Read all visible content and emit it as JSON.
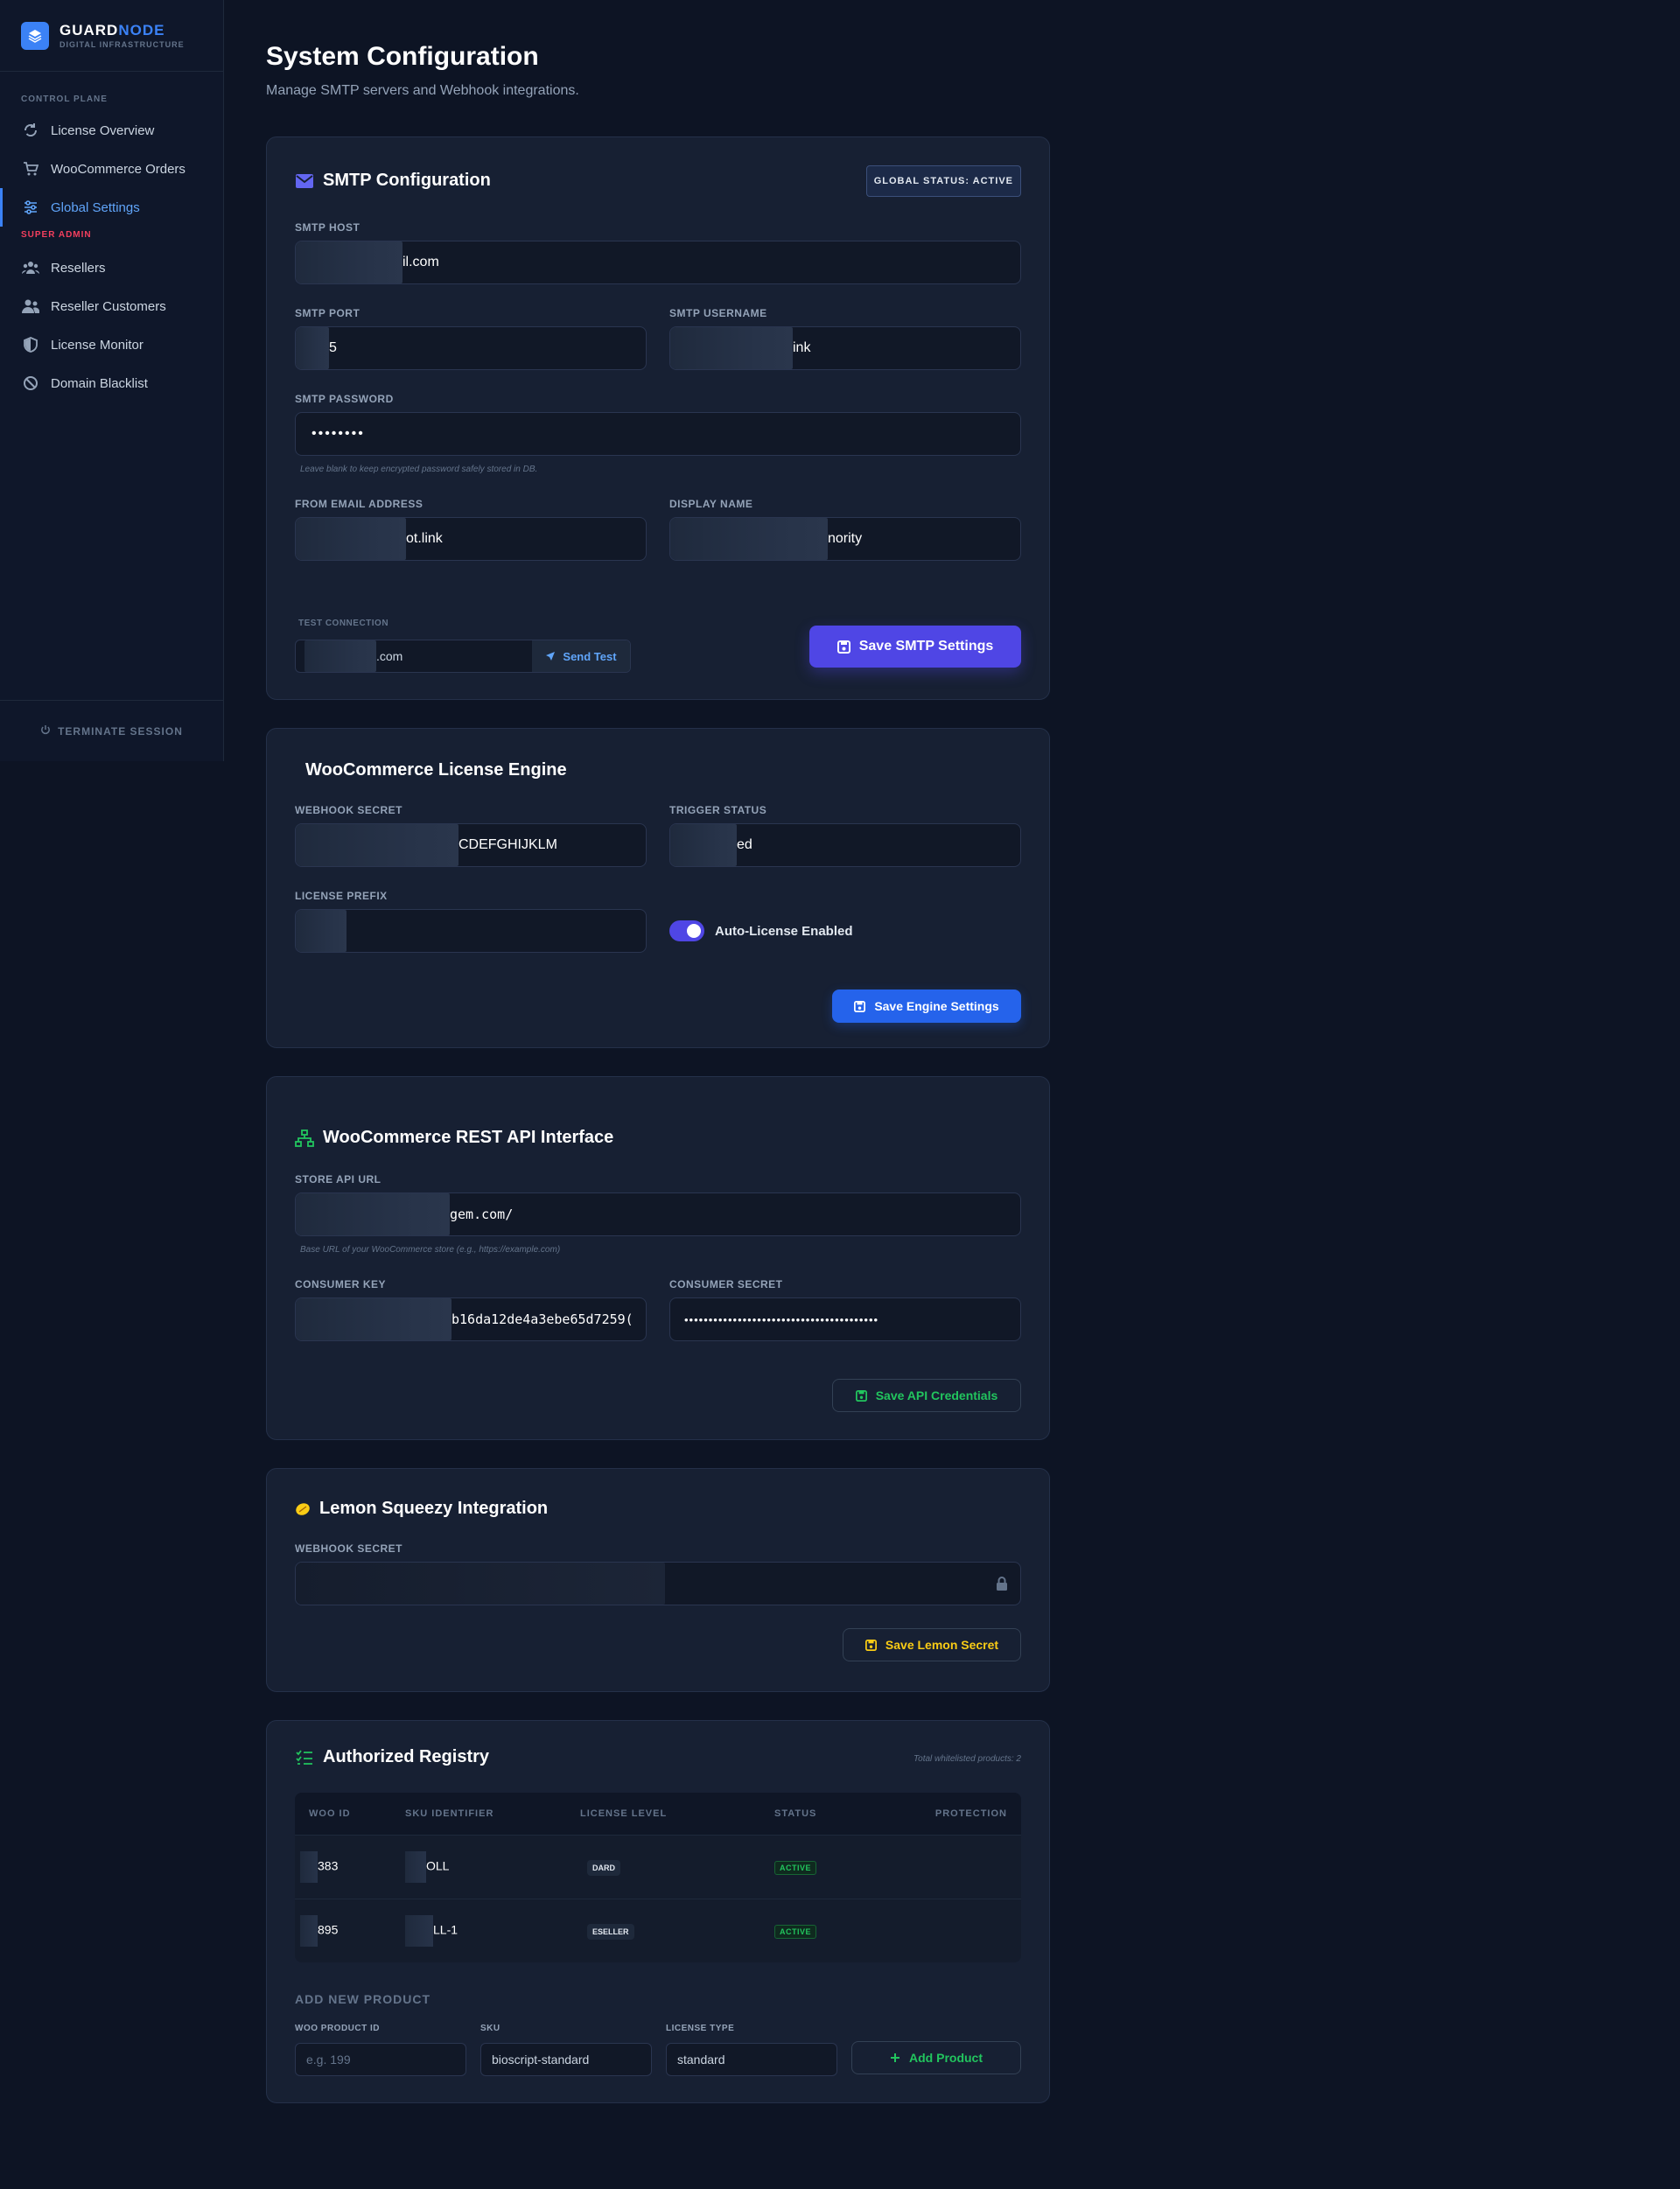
{
  "brand": {
    "name_a": "GUARD",
    "name_b": "NODE",
    "subtitle": "DIGITAL INFRASTRUCTURE"
  },
  "sidebar": {
    "section_control": "CONTROL PLANE",
    "items": [
      {
        "label": "License Overview",
        "icon": "refresh-icon"
      },
      {
        "label": "WooCommerce Orders",
        "icon": "cart-icon"
      },
      {
        "label": "Global Settings",
        "icon": "sliders-icon",
        "active": true
      }
    ],
    "section_admin": "SUPER ADMIN",
    "admin_items": [
      {
        "label": "Resellers",
        "icon": "users-group-icon"
      },
      {
        "label": "Reseller Customers",
        "icon": "users-icon"
      },
      {
        "label": "License Monitor",
        "icon": "shield-icon"
      },
      {
        "label": "Domain Blacklist",
        "icon": "ban-icon"
      }
    ],
    "footer": "TERMINATE SESSION"
  },
  "header": {
    "title": "System Configuration",
    "subtitle": "Manage SMTP servers and Webhook integrations."
  },
  "smtp": {
    "title": "SMTP Configuration",
    "status_badge": "GLOBAL STATUS: ACTIVE",
    "host_label": "SMTP HOST",
    "host_value": "il.com",
    "port_label": "SMTP PORT",
    "port_value": "5",
    "username_label": "SMTP USERNAME",
    "username_value": "ink",
    "password_label": "SMTP PASSWORD",
    "password_value": "••••••••",
    "password_hint": "Leave blank to keep encrypted password safely stored in DB.",
    "from_label": "FROM EMAIL ADDRESS",
    "from_value": "ot.link",
    "display_label": "DISPLAY NAME",
    "display_value": "nority",
    "test_label": "TEST CONNECTION",
    "test_value": ".com",
    "send_test": "Send Test",
    "save": "Save SMTP Settings"
  },
  "woo_engine": {
    "title": "WooCommerce License Engine",
    "secret_label": "WEBHOOK SECRET",
    "secret_value": "CDEFGHIJKLM",
    "trigger_label": "TRIGGER STATUS",
    "trigger_value": "ed",
    "prefix_label": "LICENSE PREFIX",
    "prefix_value": "",
    "auto_label": "Auto-License Enabled",
    "save": "Save Engine Settings"
  },
  "woo_api": {
    "title": "WooCommerce REST API Interface",
    "url_label": "STORE API URL",
    "url_value": "gem.com/",
    "url_hint": "Base URL of your WooCommerce store (e.g., https://example.com)",
    "key_label": "CONSUMER KEY",
    "key_value": "b16da12de4a3ebe65d7259(",
    "secret_label": "CONSUMER SECRET",
    "secret_value": "••••••••••••••••••••••••••••••••••••••••",
    "save": "Save API Credentials"
  },
  "lemon": {
    "title": "Lemon Squeezy Integration",
    "secret_label": "WEBHOOK SECRET",
    "save": "Save Lemon Secret"
  },
  "registry": {
    "title": "Authorized Registry",
    "total": "Total whitelisted products: 2",
    "columns": [
      "WOO ID",
      "SKU IDENTIFIER",
      "LICENSE LEVEL",
      "STATUS",
      "PROTECTION"
    ],
    "rows": [
      {
        "id": "383",
        "sku": "OLL",
        "level": "DARD",
        "status": "ACTIVE"
      },
      {
        "id": "895",
        "sku": "LL-1",
        "level": "ESELLER",
        "status": "ACTIVE"
      }
    ],
    "add_title": "ADD NEW PRODUCT",
    "woo_id_label": "WOO PRODUCT ID",
    "woo_id_placeholder": "e.g. 199",
    "sku_label": "SKU",
    "sku_value": "bioscript-standard",
    "type_label": "LICENSE TYPE",
    "type_value": "standard",
    "add_button": "Add Product"
  },
  "colors": {
    "accent": "#3b82f6",
    "primary_button": "#4f46e5",
    "success": "#22c55e",
    "warning": "#facc15",
    "danger": "#f43f5e"
  }
}
